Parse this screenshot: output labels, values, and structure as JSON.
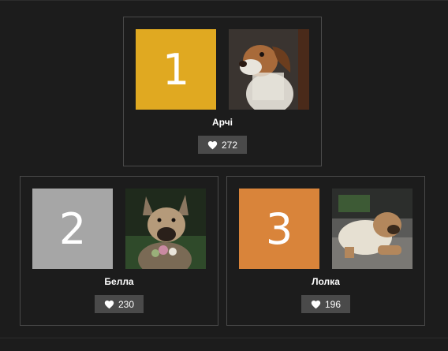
{
  "colors": {
    "background": "#1c1c1c",
    "card_border": "#4a4a4a",
    "rank_1": "#e0a921",
    "rank_2": "#a6a6a6",
    "rank_3": "#d9843a",
    "likes_bg": "#4a4a4a"
  },
  "leaderboard": [
    {
      "rank": "1",
      "name": "Арчі",
      "likes": "272",
      "photo_icon": "dog-photo-hound"
    },
    {
      "rank": "2",
      "name": "Белла",
      "likes": "230",
      "photo_icon": "dog-photo-shepherd"
    },
    {
      "rank": "3",
      "name": "Лолка",
      "likes": "196",
      "photo_icon": "dog-photo-sharpei"
    }
  ]
}
